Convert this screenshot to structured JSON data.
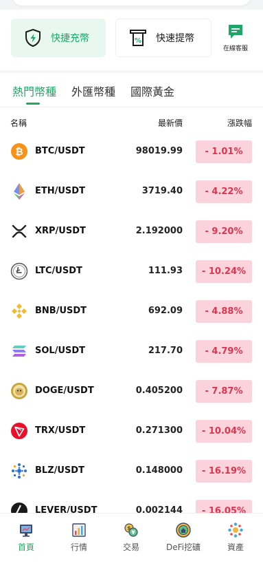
{
  "actions": {
    "deposit_label": "快捷充幣",
    "withdraw_label": "快速提幣",
    "support_label": "在線客服"
  },
  "tabs": [
    {
      "label": "熱門幣種",
      "active": true
    },
    {
      "label": "外匯幣種",
      "active": false
    },
    {
      "label": "國際黃金",
      "active": false
    }
  ],
  "columns": {
    "name": "名稱",
    "price": "最新價",
    "change": "漲跌幅"
  },
  "rows": [
    {
      "pair": "BTC/USDT",
      "price": "98019.99",
      "change": "- 1.01%",
      "icon": "btc-icon"
    },
    {
      "pair": "ETH/USDT",
      "price": "3719.40",
      "change": "- 4.22%",
      "icon": "eth-icon"
    },
    {
      "pair": "XRP/USDT",
      "price": "2.192000",
      "change": "- 9.20%",
      "icon": "xrp-icon"
    },
    {
      "pair": "LTC/USDT",
      "price": "111.93",
      "change": "- 10.24%",
      "icon": "ltc-icon"
    },
    {
      "pair": "BNB/USDT",
      "price": "692.09",
      "change": "- 4.88%",
      "icon": "bnb-icon"
    },
    {
      "pair": "SOL/USDT",
      "price": "217.70",
      "change": "- 4.79%",
      "icon": "sol-icon"
    },
    {
      "pair": "DOGE/USDT",
      "price": "0.405200",
      "change": "- 7.87%",
      "icon": "doge-icon"
    },
    {
      "pair": "TRX/USDT",
      "price": "0.271300",
      "change": "- 10.04%",
      "icon": "trx-icon"
    },
    {
      "pair": "BLZ/USDT",
      "price": "0.148000",
      "change": "- 16.19%",
      "icon": "blz-icon"
    },
    {
      "pair": "LEVER/USDT",
      "price": "0.002144",
      "change": "- 16.05%",
      "icon": "lever-icon"
    }
  ],
  "nav": [
    {
      "label": "首頁",
      "icon": "home-icon",
      "active": true
    },
    {
      "label": "行情",
      "icon": "market-icon",
      "active": false
    },
    {
      "label": "交易",
      "icon": "trade-icon",
      "active": false
    },
    {
      "label": "DeFi挖礦",
      "icon": "defi-mining-icon",
      "active": false
    },
    {
      "label": "資產",
      "icon": "assets-icon",
      "active": false
    }
  ],
  "colors": {
    "accent": "#1ea766",
    "down_text": "#e0334e",
    "down_bg": "#fbd3dc"
  }
}
